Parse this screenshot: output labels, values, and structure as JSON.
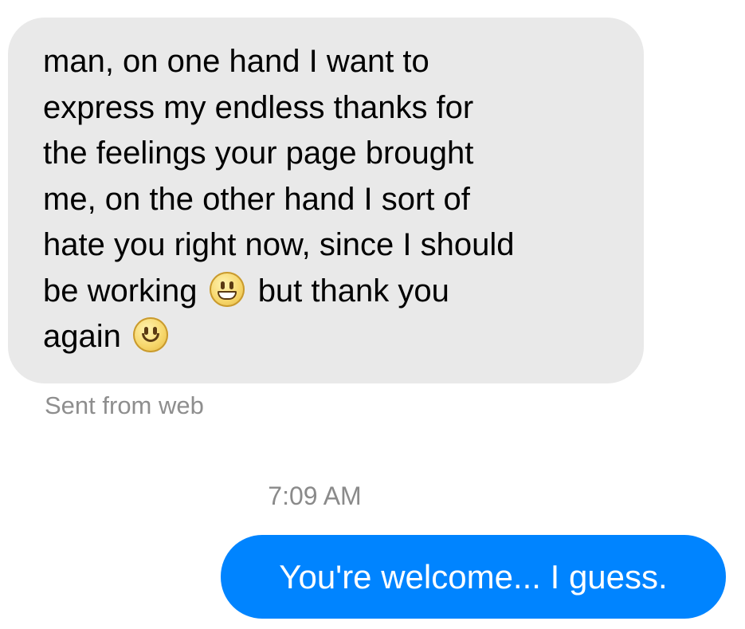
{
  "conversation": {
    "incoming_message": {
      "lines": [
        "man, on one hand I want to",
        "express my endless thanks for",
        "the feelings your page brought",
        "me, on the other hand I sort of",
        "hate you right now, since I should",
        "be working",
        "but thank you",
        "again"
      ],
      "emojis": [
        "grinning-face-icon",
        "slightly-smiling-face-icon"
      ],
      "bubble_color": "#e9e9e9",
      "sent_via": "Sent from web"
    },
    "timestamp": "7:09 AM",
    "outgoing_message": {
      "text": "You're welcome... I guess.",
      "bubble_color": "#0084ff"
    }
  }
}
